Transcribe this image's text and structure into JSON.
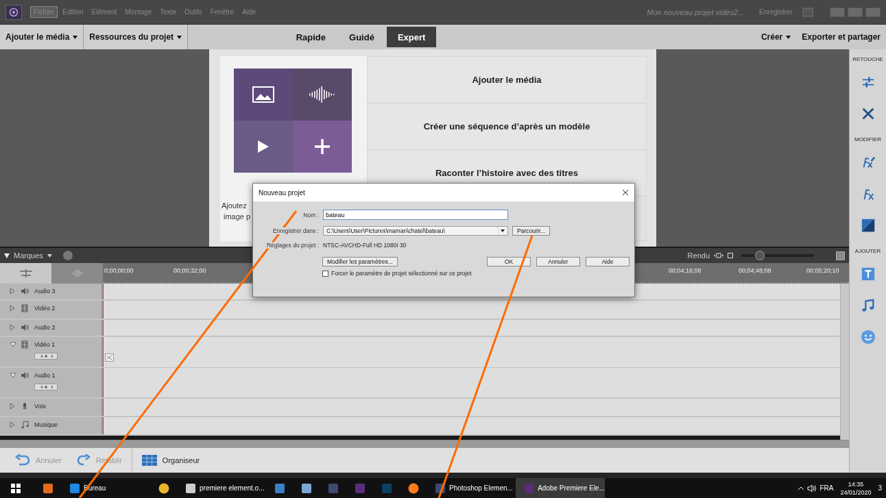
{
  "menu_bar": {
    "items": [
      {
        "label": "Fichier",
        "selected": true
      },
      {
        "label": "Edition",
        "selected": false
      },
      {
        "label": "Elément",
        "selected": false
      },
      {
        "label": "Montage",
        "selected": false
      },
      {
        "label": "Texte",
        "selected": false
      },
      {
        "label": "Outils",
        "selected": false
      },
      {
        "label": "Fenêtre",
        "selected": false
      },
      {
        "label": "Aide",
        "selected": false
      }
    ],
    "project_title": "Mon nouveau projet vidéo2...",
    "save_label": "Enregistrer"
  },
  "toolbar": {
    "left_menus": [
      "Ajouter le média",
      "Ressources du projet"
    ],
    "modes": [
      {
        "label": "Rapide",
        "selected": false
      },
      {
        "label": "Guidé",
        "selected": false
      },
      {
        "label": "Expert",
        "selected": true
      }
    ],
    "right_menus": [
      {
        "label": "Créer",
        "dropdown": true
      },
      {
        "label": "Exporter et partager",
        "dropdown": false
      }
    ]
  },
  "welcome": {
    "actions": [
      "Ajouter le média",
      "Créer une séquence d’après un modèle",
      "Raconter l’histoire avec des titres"
    ],
    "hint_lines": [
      "Ajoutez",
      "image p"
    ]
  },
  "dialog": {
    "title": "Nouveau projet",
    "name_label": "Nom :",
    "name_value": "bateau",
    "folder_label": "Enregistrer dans :",
    "folder_value": "C:\\Users\\User\\Pictures\\maman\\chatel\\bateau\\",
    "browse": "Parcourir...",
    "settings_label": "Réglages du projet :",
    "settings_value": "NTSC-AVCHD-Full HD 1080i 30",
    "modify": "Modifier les paramètres...",
    "buttons": [
      "OK",
      "Annuler",
      "Aide"
    ],
    "force": {
      "label": "Forcer le paramètre de projet sélectionné sur ce projet",
      "checked": false
    }
  },
  "timeline": {
    "markers_label": "Marques",
    "render_label": "Rendu",
    "zoom": {
      "level": 0.22
    },
    "timecodes": [
      "0;00;00;00",
      "00;00;32;00",
      "00;04;16;08",
      "00;04;48;08",
      "00;05;20;10"
    ],
    "tracks": [
      {
        "name": "Audio 3",
        "kind": "audio",
        "expanded": false
      },
      {
        "name": "Vidéo 2",
        "kind": "video",
        "expanded": false
      },
      {
        "name": "Audio 2",
        "kind": "audio",
        "expanded": false
      },
      {
        "name": "Vidéo 1",
        "kind": "video",
        "expanded": true
      },
      {
        "name": "Audio 1",
        "kind": "audio",
        "expanded": true
      },
      {
        "name": "Voix",
        "kind": "voice",
        "expanded": false
      },
      {
        "name": "Musique",
        "kind": "music",
        "expanded": false
      }
    ]
  },
  "bottom_bar": {
    "undo": "Annuler",
    "redo": "Rétablir",
    "organizer": "Organiseur"
  },
  "right_panel": {
    "sections": [
      {
        "title": "RETOUCHE",
        "tools": [
          {
            "kind": "adjust"
          },
          {
            "kind": "tools"
          }
        ]
      },
      {
        "title": "MODIFIER",
        "tools": [
          {
            "kind": "fx-brush"
          },
          {
            "kind": "fx"
          },
          {
            "kind": "matte"
          }
        ]
      },
      {
        "title": "AJOUTER",
        "tools": [
          {
            "kind": "title"
          },
          {
            "kind": "music"
          },
          {
            "kind": "smiley"
          }
        ]
      }
    ]
  },
  "taskbar": {
    "items": [
      {
        "kind": "player",
        "selected": false
      },
      {
        "kind": "folder",
        "label": "Bureau",
        "selected": false
      },
      {
        "kind": "photos",
        "selected": false
      },
      {
        "kind": "document",
        "label": "premiere element.o...",
        "selected": false
      },
      {
        "kind": "books",
        "selected": false
      },
      {
        "kind": "picture",
        "selected": false
      },
      {
        "kind": "elements",
        "selected": false
      },
      {
        "kind": "premiere",
        "selected": false
      },
      {
        "kind": "photoshop",
        "selected": false
      },
      {
        "kind": "firefox",
        "selected": false
      },
      {
        "kind": "elements",
        "label": "Photoshop Elemen...",
        "selected": false
      },
      {
        "kind": "premiere",
        "label": "Adobe Premiere Ele...",
        "selected": true
      }
    ],
    "language": "FRA",
    "time": "14:35",
    "date": "24/01/2020",
    "notifications": "3"
  }
}
